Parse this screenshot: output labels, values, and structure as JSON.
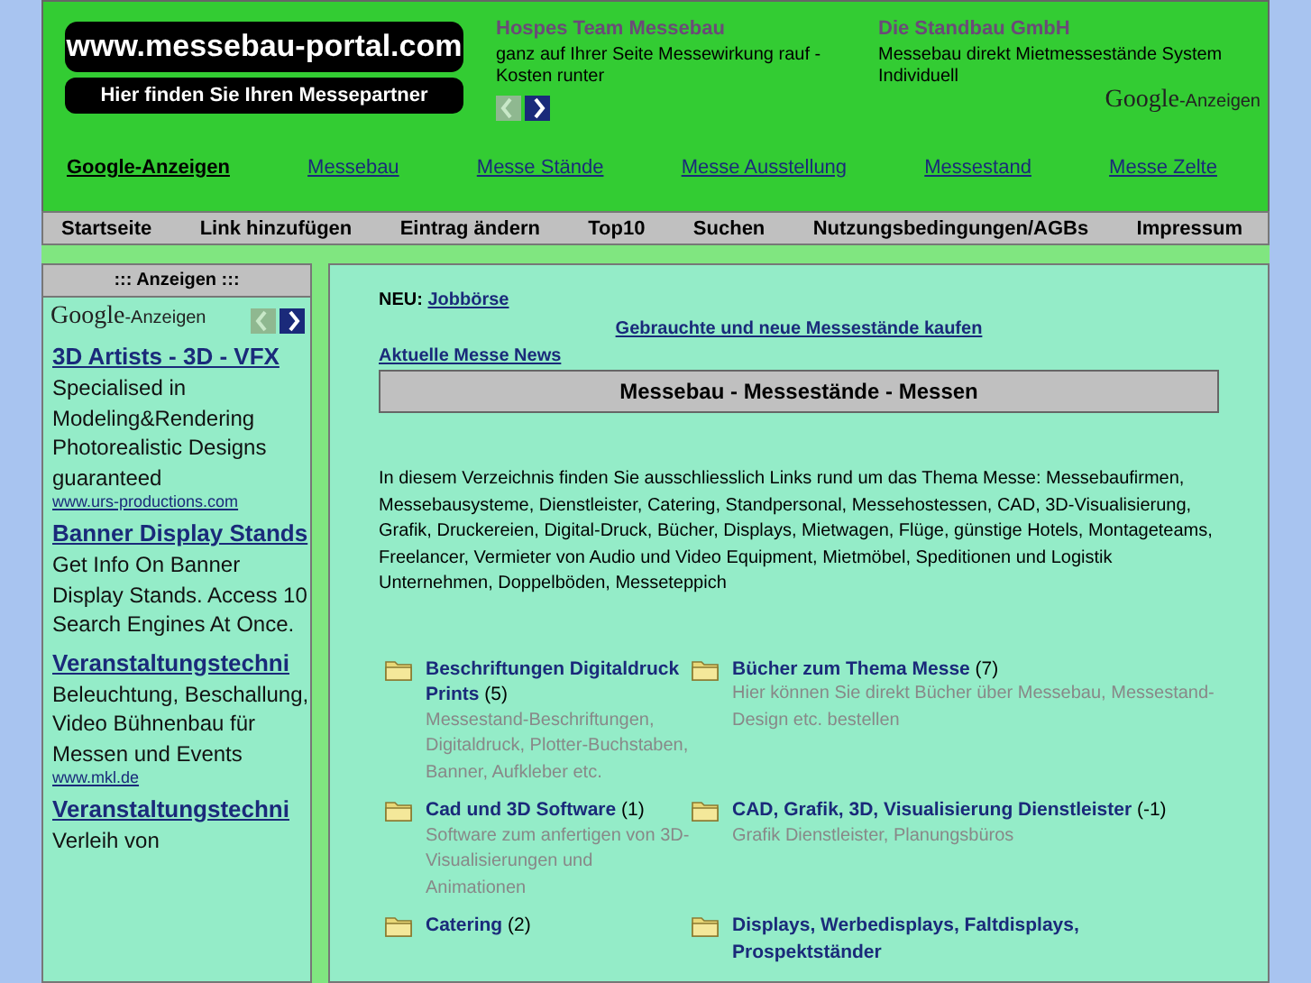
{
  "header": {
    "logo": "www.messebau-portal.com",
    "tagline": "Hier finden Sie Ihren Messepartner",
    "ads": [
      {
        "title": "Hospes Team Messebau",
        "text": "ganz auf Ihrer Seite Messewirkung rauf - Kosten runter"
      },
      {
        "title": "Die Standbau GmbH",
        "text": "Messebau direkt Mietmessestände System Individuell"
      }
    ],
    "ad_nav": [
      {
        "kind": "prev",
        "disabled": true
      },
      {
        "kind": "next",
        "disabled": false
      }
    ],
    "ad_brand": "Google",
    "ad_suffix": "-Anzeigen"
  },
  "link_row": {
    "label": "Google-Anzeigen",
    "links": [
      "Messebau",
      "Messe Stände",
      "Messe Ausstellung",
      "Messestand",
      "Messe Zelte"
    ]
  },
  "nav": [
    "Startseite",
    "Link hinzufügen",
    "Eintrag ändern",
    "Top10",
    "Suchen",
    "Nutzungsbedingungen/AGBs",
    "Impressum"
  ],
  "sidebar": {
    "title": "::: Anzeigen :::",
    "brand": "Google",
    "suffix": "-Anzeigen",
    "ad_nav": [
      {
        "kind": "prev",
        "disabled": true
      },
      {
        "kind": "next",
        "disabled": false
      }
    ],
    "ads": [
      {
        "title": "3D Artists - 3D - VFX",
        "text": "Specialised in Modeling&Rendering Photorealistic Designs guaranteed",
        "url": "www.urs-productions.com"
      },
      {
        "title": "Banner Display Stands",
        "text": "Get Info On Banner Display Stands. Access 10 Search Engines At Once."
      },
      {
        "title": "Veranstaltungstechni",
        "text": "Beleuchtung, Beschallung, Video Bühnenbau für Messen und Events",
        "url": "www.mkl.de"
      },
      {
        "title": "Veranstaltungstechni",
        "text": "Verleih von"
      }
    ]
  },
  "main": {
    "new_label": "NEU:",
    "new_link": "Jobbörse",
    "buy_link": "Gebrauchte und neue Messestände kaufen",
    "news_link": "Aktuelle Messe News",
    "heading": "Messebau - Messestände - Messen",
    "intro": "In diesem Verzeichnis finden Sie ausschliesslich Links rund um das Thema Messe: Messebaufirmen, Messebausysteme, Dienstleister, Catering, Standpersonal, Messehostessen, CAD, 3D-Visualisierung, Grafik, Druckereien, Digital-Druck, Bücher, Displays, Mietwagen, Flüge, günstige Hotels, Montageteams, Freelancer, Vermieter von Audio und Video Equipment, Mietmöbel, Speditionen und Logistik Unternehmen, Doppelböden, Messeteppich",
    "categories": [
      {
        "title": "Beschriftungen Digitaldruck Prints",
        "count": "(5)",
        "description": "Messestand-Beschriftungen, Digitaldruck, Plotter-Buchstaben, Banner, Aufkleber etc."
      },
      {
        "title": "Bücher zum Thema Messe",
        "count": "(7)",
        "description": "Hier können Sie direkt Bücher über Messebau, Messestand-Design etc. bestellen"
      },
      {
        "title": "Cad und 3D Software",
        "count": "(1)",
        "description": "Software zum anfertigen von 3D-Visualisierungen und Animationen"
      },
      {
        "title": "CAD, Grafik, 3D, Visualisierung Dienstleister",
        "count": "(-1)",
        "description": "Grafik Dienstleister, Planungsbüros"
      },
      {
        "title": "Catering",
        "count": "(2)"
      },
      {
        "title": "Displays, Werbedisplays, Faltdisplays, Prospektständer"
      }
    ]
  }
}
